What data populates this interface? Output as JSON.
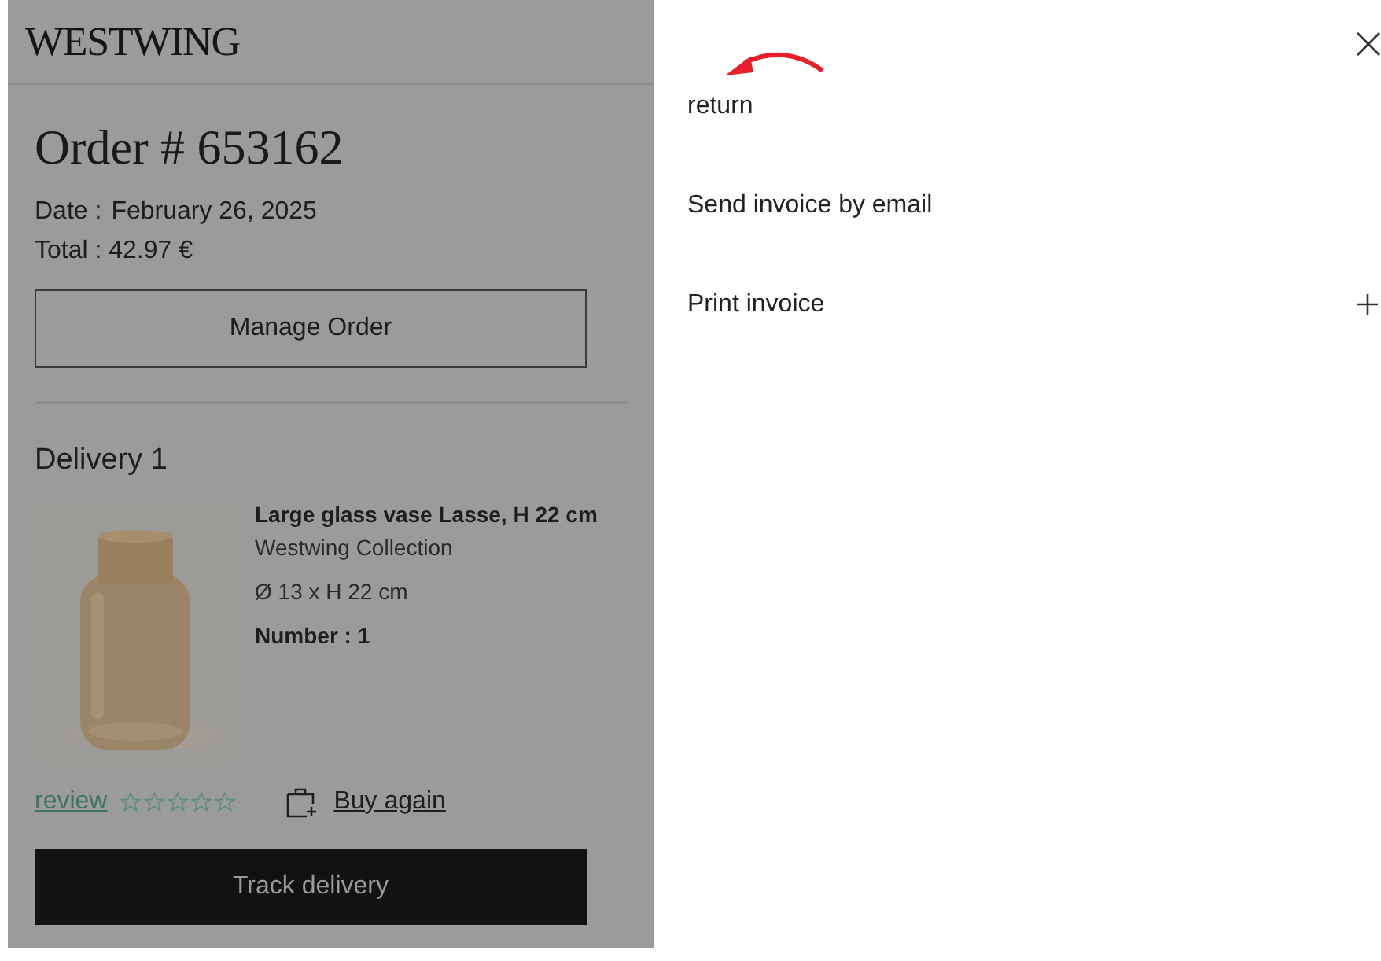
{
  "header": {
    "logo": "WESTWING"
  },
  "order": {
    "title": "Order # 653162",
    "date_label": "Date :",
    "date": "February 26, 2025",
    "total": "Total : 42.97 €",
    "manage_button": "Manage Order"
  },
  "delivery": {
    "title": "Delivery 1",
    "item": {
      "name": "Large glass vase Lasse, H 22 cm",
      "brand": "Westwing Collection",
      "size": "Ø 13 x H 22 cm",
      "quantity": "Number : 1"
    },
    "review_link": "review",
    "stars": 0,
    "buy_again": "Buy again",
    "track_button": "Track delivery"
  },
  "drawer": {
    "items": [
      {
        "kind": "link",
        "label": "return",
        "annotated": true
      },
      {
        "kind": "link",
        "label": "Send invoice by email",
        "annotated": false
      },
      {
        "kind": "expandable",
        "label": "Print invoice",
        "annotated": false,
        "expanded": false
      }
    ]
  }
}
